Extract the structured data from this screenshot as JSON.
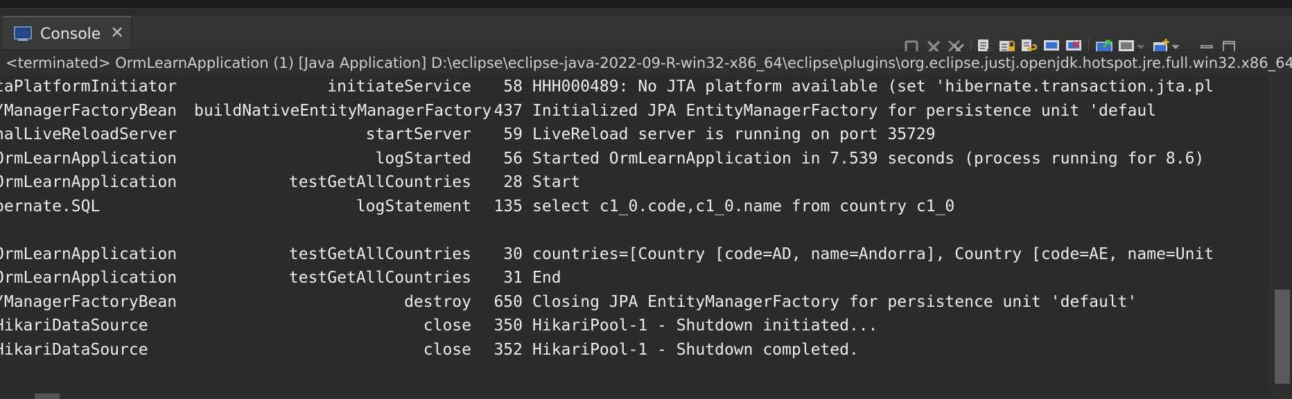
{
  "tab": {
    "label": "Console"
  },
  "status": "<terminated> OrmLearnApplication (1) [Java Application] D:\\eclipse\\eclipse-java-2022-09-R-win32-x86_64\\eclipse\\plugins\\org.eclipse.justj.openjdk.hotspot.jre.full.win32.x86_64_",
  "toolbar_icons": [
    "terminate-icon",
    "remove-launch-icon",
    "remove-all-terminated-icon",
    "clear-console-icon",
    "scroll-lock-icon",
    "word-wrap-icon",
    "show-on-stdout-icon",
    "show-on-stderr-icon",
    "pin-console-icon",
    "display-console-icon",
    "open-console-icon",
    "minimize-icon",
    "maximize-icon"
  ],
  "log": [
    {
      "logger": "taPlatformInitiator",
      "method": "initiateService",
      "line": "58",
      "msg": "HHH000489: No JTA platform available (set 'hibernate.transaction.jta.pl"
    },
    {
      "logger": "/ManagerFactoryBean",
      "method": "buildNativeEntityManagerFactory",
      "line": "437",
      "msg": "Initialized JPA EntityManagerFactory for persistence unit 'defaul"
    },
    {
      "logger": "nalLiveReloadServer",
      "method": "startServer",
      "line": "59",
      "msg": "LiveReload server is running on port 35729"
    },
    {
      "logger": "OrmLearnApplication",
      "method": "logStarted",
      "line": "56",
      "msg": "Started OrmLearnApplication in 7.539 seconds (process running for 8.6)"
    },
    {
      "logger": "OrmLearnApplication",
      "method": "testGetAllCountries",
      "line": "28",
      "msg": "Start"
    },
    {
      "logger": "pernate.SQL",
      "method": "logStatement",
      "line": "135",
      "msg": "select c1_0.code,c1_0.name from country c1_0"
    },
    {
      "logger": "",
      "method": "",
      "line": "",
      "msg": ""
    },
    {
      "logger": "OrmLearnApplication",
      "method": "testGetAllCountries",
      "line": "30",
      "msg": "countries=[Country [code=AD, name=Andorra], Country [code=AE, name=Unit"
    },
    {
      "logger": "OrmLearnApplication",
      "method": "testGetAllCountries",
      "line": "31",
      "msg": "End"
    },
    {
      "logger": "/ManagerFactoryBean",
      "method": "destroy",
      "line": "650",
      "msg": "Closing JPA EntityManagerFactory for persistence unit 'default'"
    },
    {
      "logger": "HikariDataSource",
      "method": "close",
      "line": "350",
      "msg": "HikariPool-1 - Shutdown initiated..."
    },
    {
      "logger": "HikariDataSource",
      "method": "close",
      "line": "352",
      "msg": "HikariPool-1 - Shutdown completed."
    }
  ]
}
